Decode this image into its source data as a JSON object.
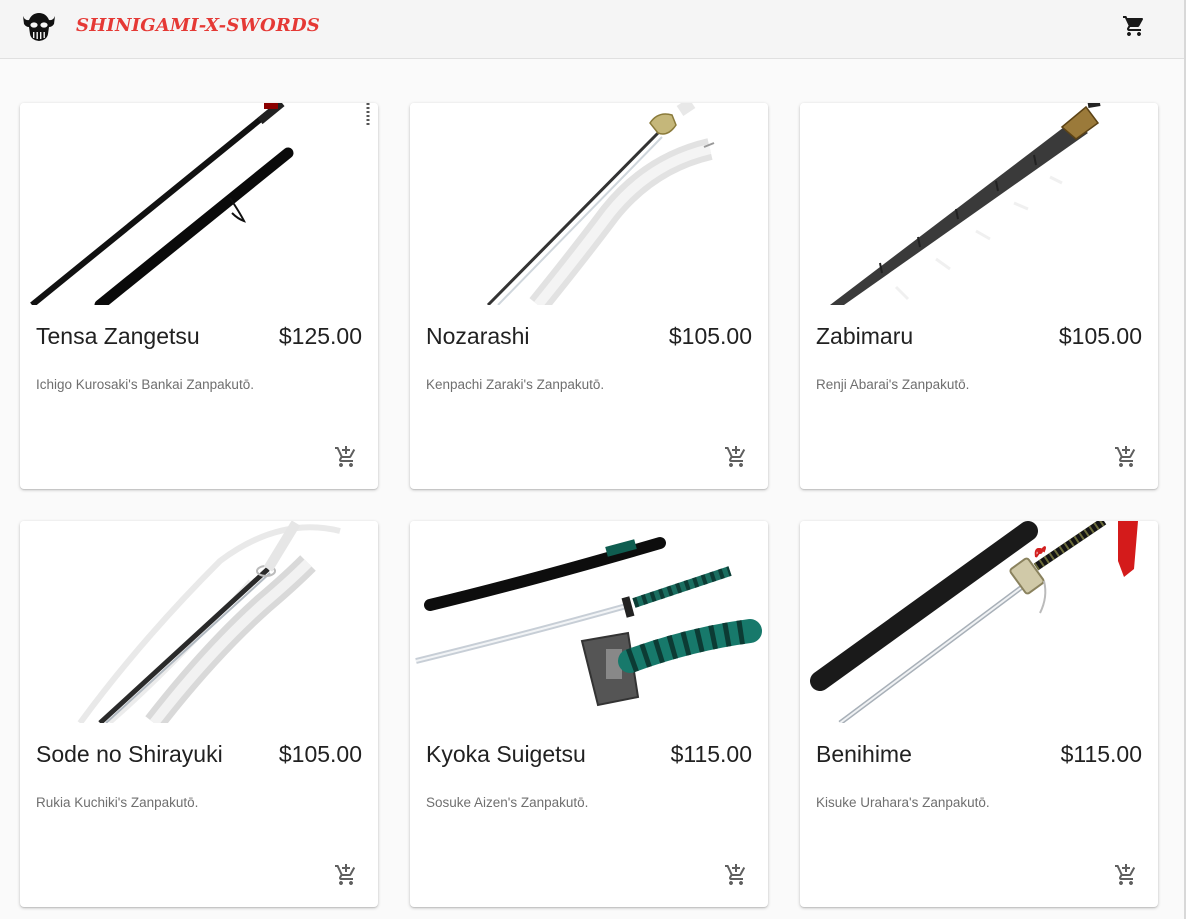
{
  "app": {
    "brand": "SHINIGAMI-X-SWORDS",
    "brand_color": "#e53935"
  },
  "header": {
    "logo_icon": "skull-icon",
    "cart_icon": "shopping-cart-icon"
  },
  "products": [
    {
      "name": "Tensa Zangetsu",
      "price": "$125.00",
      "description": "Ichigo Kurosaki's Bankai Zanpakutō.",
      "image": "katana-black-image",
      "cart_icon": "add-shopping-cart-icon"
    },
    {
      "name": "Nozarashi",
      "price": "$105.00",
      "description": "Kenpachi Zaraki's Zanpakutō.",
      "image": "katana-white-image",
      "cart_icon": "add-shopping-cart-icon"
    },
    {
      "name": "Zabimaru",
      "price": "$105.00",
      "description": "Renji Abarai's Zanpakutō.",
      "image": "segmented-sword-image",
      "cart_icon": "add-shopping-cart-icon"
    },
    {
      "name": "Sode no Shirayuki",
      "price": "$105.00",
      "description": "Rukia Kuchiki's Zanpakutō.",
      "image": "white-katana-ribbon-image",
      "cart_icon": "add-shopping-cart-icon"
    },
    {
      "name": "Kyoka Suigetsu",
      "price": "$115.00",
      "description": "Sosuke Aizen's Zanpakutō.",
      "image": "green-wrapped-katana-image",
      "cart_icon": "add-shopping-cart-icon"
    },
    {
      "name": "Benihime",
      "price": "$115.00",
      "description": "Kisuke Urahara's Zanpakutō.",
      "image": "cane-sword-image",
      "cart_icon": "add-shopping-cart-icon"
    }
  ]
}
